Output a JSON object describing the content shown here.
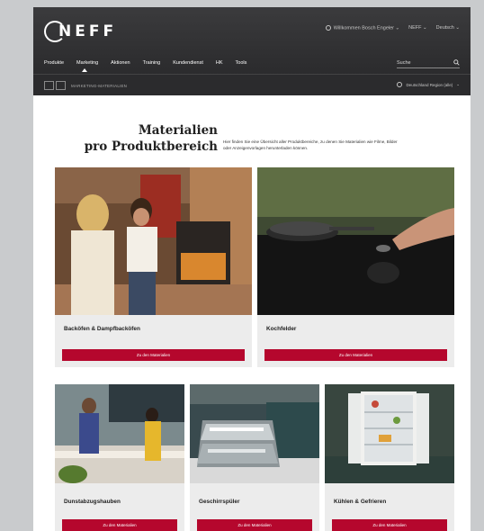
{
  "header": {
    "logo_text": "NEFF",
    "utility": {
      "location": "Willkommen Bosch Engeler",
      "brand": "NEFF",
      "language": "Deutsch"
    },
    "nav": [
      "Produkte",
      "Marketing",
      "Aktionen",
      "Training",
      "Kundendienst",
      "HK",
      "Tools"
    ],
    "active_nav": "Marketing",
    "search_label": "Suche",
    "breadcrumb": "MARKETING-MATERIALIEN",
    "region": "Deutschland Region (alle)"
  },
  "intro": {
    "title_line1": "Materialien",
    "title_line2": "pro Produktbereich",
    "text": "Hier finden Sie eine Übersicht aller Produktbereiche, zu denen Sie Materialien wie Filme, Bilder oder Anzeigenvorlagen herunterladen können."
  },
  "cards": [
    {
      "title": "Backöfen & Dampfbacköfen",
      "button": "Zu den Materialien"
    },
    {
      "title": "Kochfelder",
      "button": "Zu den Materialien"
    },
    {
      "title": "Dunstabzugshauben",
      "button": "Zu den Materialien"
    },
    {
      "title": "Geschirrspüler",
      "button": "Zu den Materialien"
    },
    {
      "title": "Kühlen & Gefrieren",
      "button": "Zu den Materialien"
    }
  ],
  "icons": {
    "home": "home-icon",
    "share": "share-icon",
    "search": "search-icon",
    "location": "location-pin-icon",
    "chevron": "chevron-down-icon"
  },
  "colors": {
    "header_bg": "#2e2e30",
    "accent": "#b5072d",
    "card_bg": "#ececec"
  }
}
